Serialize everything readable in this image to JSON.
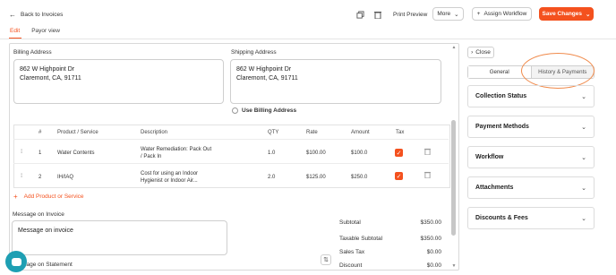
{
  "header": {
    "back_label": "Back to Invoices",
    "print_label": "Print Preview",
    "more_label": "More",
    "assign_label": "Assign Workflow",
    "save_label": "Save Changes"
  },
  "tabs": [
    {
      "label": "Edit"
    },
    {
      "label": "Payor view"
    }
  ],
  "billing": {
    "label": "Billing Address",
    "line1": "862 W Highpoint Dr",
    "line2": "Claremont, CA, 91711"
  },
  "shipping": {
    "label": "Shipping Address",
    "line1": "862 W Highpoint Dr",
    "line2": "Claremont, CA, 91711",
    "use_billing": "Use Billing Address"
  },
  "table": {
    "columns": [
      "#",
      "Product / Service",
      "Description",
      "QTY",
      "Rate",
      "Amount",
      "Tax"
    ],
    "rows": [
      {
        "num": "1",
        "product": "Water Contents",
        "desc1": "Water Remediation: Pack Out",
        "desc2": "/ Pack In",
        "qty": "1.0",
        "rate": "$100.00",
        "amount": "$100.0"
      },
      {
        "num": "2",
        "product": "IH/IAQ",
        "desc1": "Cost for using an Indoor",
        "desc2": "Hygienist or Indoor Air...",
        "qty": "2.0",
        "rate": "$125.00",
        "amount": "$250.0"
      }
    ],
    "add_label": "Add Product or Service"
  },
  "message": {
    "label": "Message on Invoice",
    "value": "Message on invoice",
    "statement_label": "Message on Statement"
  },
  "summary": {
    "subtotal_label": "Subtotal",
    "subtotal": "$350.00",
    "taxable_label": "Taxable Subtotal",
    "taxable": "$350.00",
    "tax_label": "Sales Tax",
    "tax": "$0.00",
    "discount_label": "Discount",
    "discount": "$0.00"
  },
  "side": {
    "close_label": "Close",
    "seg_general": "General",
    "seg_history": "History & Payments",
    "sections": [
      "Collection Status",
      "Payment Methods",
      "Workflow",
      "Attachments",
      "Discounts & Fees"
    ]
  },
  "colors": {
    "accent": "#f4511e",
    "highlight": "#f08a4b",
    "chat": "#1e9fb3"
  }
}
